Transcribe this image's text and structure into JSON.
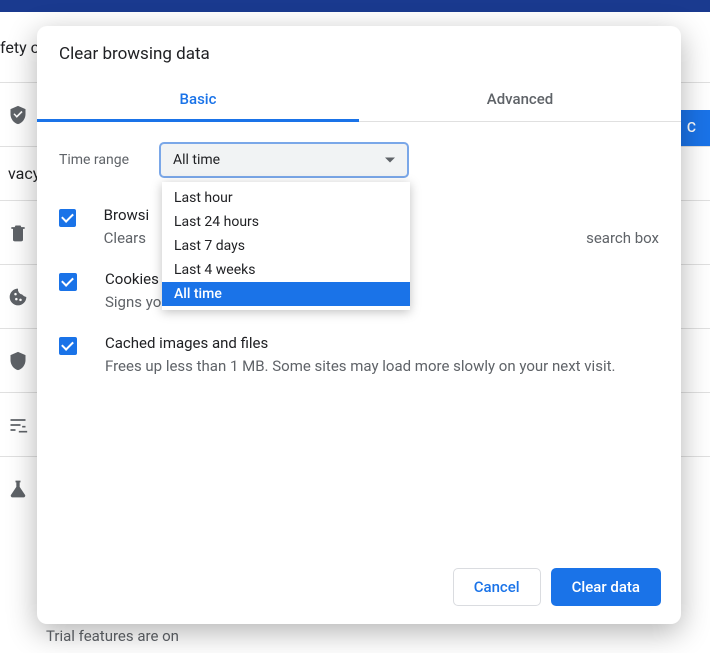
{
  "background": {
    "section_safety": "fety check",
    "section_privacy": "vacy",
    "check_button_fragment": "C",
    "trial_text": "Trial features are on"
  },
  "dialog": {
    "title": "Clear browsing data",
    "tabs": {
      "basic": "Basic",
      "advanced": "Advanced"
    },
    "time": {
      "label": "Time range",
      "value": "All time",
      "options": [
        "Last hour",
        "Last 24 hours",
        "Last 7 days",
        "Last 4 weeks",
        "All time"
      ],
      "selected_index": 4
    },
    "options": [
      {
        "title": "Browsing history",
        "title_visible": "Browsi",
        "subtitle": "Clears history and autocompletions in the search box",
        "subtitle_left": "Clears ",
        "subtitle_right": "search box",
        "checked": true
      },
      {
        "title": "Cookies and other site data",
        "subtitle": "Signs you out of most sites.",
        "checked": true
      },
      {
        "title": "Cached images and files",
        "subtitle": "Frees up less than 1 MB. Some sites may load more slowly on your next visit.",
        "checked": true
      }
    ],
    "footer": {
      "cancel": "Cancel",
      "clear": "Clear data"
    }
  }
}
